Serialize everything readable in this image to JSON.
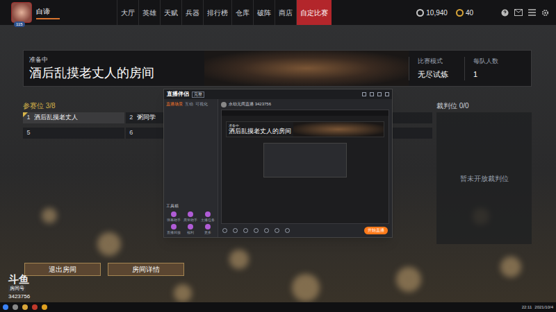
{
  "topbar": {
    "player": {
      "name": "白谛",
      "level": "115"
    },
    "nav": [
      {
        "label": "大厅",
        "selected": false
      },
      {
        "label": "英雄",
        "selected": false
      },
      {
        "label": "天赋",
        "selected": false
      },
      {
        "label": "兵器",
        "selected": false
      },
      {
        "label": "排行榜",
        "selected": false
      },
      {
        "label": "仓库",
        "selected": false
      },
      {
        "label": "破阵",
        "selected": false
      },
      {
        "label": "商店",
        "selected": false
      },
      {
        "label": "自定比赛",
        "selected": true
      }
    ],
    "currencies": [
      {
        "amount": "10,940",
        "color": "#c9c9c9"
      },
      {
        "amount": "40",
        "color": "#d9a63a"
      }
    ]
  },
  "room": {
    "status": "准备中",
    "title": "酒后乱摸老丈人的房间",
    "mode_label": "比赛模式",
    "mode": "无尽试炼",
    "team_size_label": "每队人数",
    "team_size": "1"
  },
  "participants": {
    "label": "参赛位 3/8",
    "slots": [
      {
        "number": "1",
        "name": "酒后乱摸老丈人",
        "selected": true
      },
      {
        "number": "2",
        "name": "粥同学",
        "selected": false
      },
      {
        "number": "",
        "name": "",
        "selected": false
      },
      {
        "number": "",
        "name": "",
        "selected": false
      },
      {
        "number": "5",
        "name": "",
        "selected": false
      },
      {
        "number": "6",
        "name": "",
        "selected": false
      },
      {
        "number": "",
        "name": "",
        "selected": false
      },
      {
        "number": "",
        "name": "",
        "selected": false
      }
    ]
  },
  "referees": {
    "label": "裁判位 0/0",
    "empty": "暂未开放裁判位"
  },
  "buttons": [
    "退出房间",
    "房间详情"
  ],
  "watermark": {
    "brand": "斗鱼",
    "room_label": "房间号",
    "room_id": "3423756"
  },
  "overlay": {
    "app": "直播伴侣",
    "badge": "完整",
    "tabs": [
      {
        "label": "直播场景",
        "selected": true
      },
      {
        "label": "互动",
        "selected": false
      },
      {
        "label": "可视化",
        "selected": false
      }
    ],
    "toolbox_label": "工具箱",
    "tools": [
      "弹幕助手",
      "房管助手",
      "主播任务",
      "直播回放",
      "福利",
      "更多"
    ],
    "room": "永劫无间直播 3423756",
    "preview": {
      "status": "准备中",
      "title": "酒后乱摸老丈人的房间"
    },
    "start_button": "开始直播"
  },
  "taskbar": {
    "time": "22:11",
    "date": "2021/10/4"
  }
}
